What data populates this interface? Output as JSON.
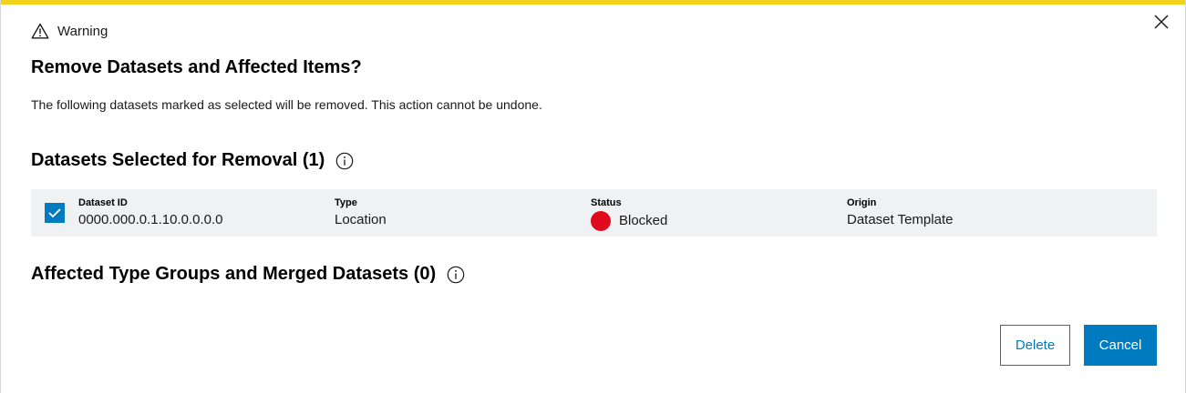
{
  "colors": {
    "accent": "#007bc0",
    "warning_strip": "#f2d21a",
    "status_blocked": "#e00a1e",
    "row_background": "#eff1f2"
  },
  "header": {
    "warning_icon": "warning-triangle-icon",
    "warning_label": "Warning",
    "close_icon": "close-icon"
  },
  "dialog": {
    "title": "Remove Datasets and Affected Items?",
    "description": "The following datasets marked as selected will be removed. This action cannot be undone."
  },
  "selected_section": {
    "heading": "Datasets Selected for Removal (1)",
    "info_icon": "info-icon",
    "columns": {
      "id": "Dataset ID",
      "type": "Type",
      "status": "Status",
      "origin": "Origin"
    },
    "rows": [
      {
        "checked": true,
        "id": "0000.000.0.1.10.0.0.0.0",
        "type": "Location",
        "status": "Blocked",
        "origin": "Dataset Template"
      }
    ]
  },
  "affected_section": {
    "heading": "Affected Type Groups and Merged Datasets (0)",
    "info_icon": "info-icon"
  },
  "buttons": {
    "delete": "Delete",
    "cancel": "Cancel"
  }
}
